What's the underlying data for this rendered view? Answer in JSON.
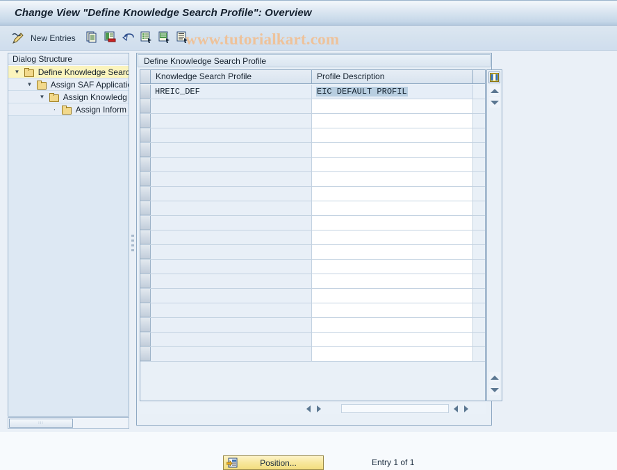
{
  "window": {
    "title": "Change View \"Define Knowledge Search Profile\": Overview"
  },
  "toolbar": {
    "pencil_icon": "pencil-icon",
    "new_entries_label": "New Entries",
    "icons": [
      {
        "name": "copy-icon"
      },
      {
        "name": "delete-icon"
      },
      {
        "name": "undo-icon"
      },
      {
        "name": "select-all-icon"
      },
      {
        "name": "deselect-all-icon"
      },
      {
        "name": "details-icon"
      }
    ],
    "watermark": "www.tutorialkart.com"
  },
  "sidebar": {
    "header": "Dialog Structure",
    "items": [
      {
        "label": "Define Knowledge Searc",
        "indent": 1,
        "twist": "▼",
        "selected": true
      },
      {
        "label": "Assign SAF Applicatio",
        "indent": 2,
        "twist": "▼",
        "selected": false
      },
      {
        "label": "Assign Knowledg",
        "indent": 3,
        "twist": "▼",
        "selected": false
      },
      {
        "label": "Assign Inform",
        "indent": 4,
        "twist": "·",
        "selected": false
      }
    ],
    "scroll_grip": "∶∶∶"
  },
  "table": {
    "caption": "Define Knowledge Search Profile",
    "columns": [
      "Knowledge Search Profile",
      "Profile Description"
    ],
    "rows": [
      {
        "profile": "HREIC_DEF",
        "description": "EIC DEFAULT PROFIL",
        "description_selected": true
      }
    ],
    "empty_row_count": 18,
    "config_icon": "table-settings-icon"
  },
  "footer": {
    "position_button": "Position...",
    "position_icon": "position-icon",
    "entry_status": "Entry 1 of 1"
  },
  "colors": {
    "title_text": "#14202e",
    "watermark": "#eec29a",
    "tree_selected": "#fbf4bd",
    "cell_selection": "#b8cee0",
    "button_yellow": "#f7e79c",
    "border": "#8fa9c3"
  }
}
